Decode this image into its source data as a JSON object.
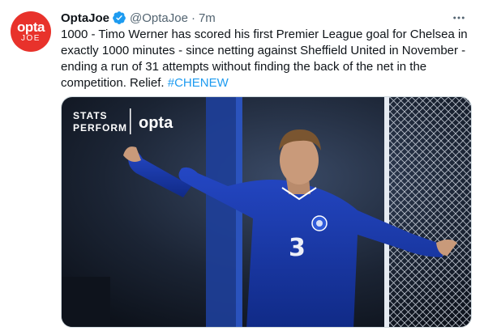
{
  "tweet": {
    "display_name": "OptaJoe",
    "handle": "@OptaJoe",
    "separator": "·",
    "time": "7m",
    "text": "1000 - Timo Werner has scored his first Premier League goal for Chelsea in exactly 1000 minutes - since netting against Sheffield United in November - ending a run of 31 attempts without finding the back of the net in the competition. Relief. ",
    "hashtag": "#CHENEW",
    "verified_icon": "verified-badge-icon",
    "more_icon": "more-options-icon"
  },
  "avatar": {
    "logo_top": "opta",
    "logo_bottom": "JOE",
    "color": "#e8322b"
  },
  "media": {
    "brand_line1": "STATS",
    "brand_line2": "PERFORM",
    "brand_opta": "opta",
    "shirt_number": "3",
    "background_color": "#1b2434",
    "shirt_color": "#1d3fb0"
  },
  "colors": {
    "link": "#1d9bf0",
    "secondary_text": "#536471",
    "primary_text": "#0f1419"
  }
}
